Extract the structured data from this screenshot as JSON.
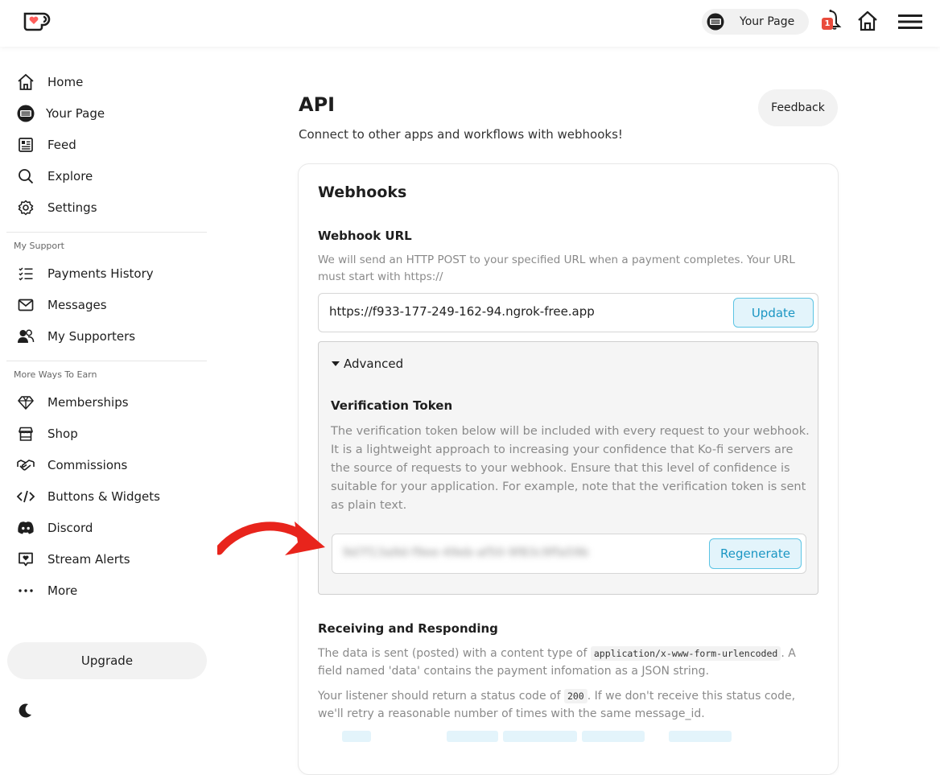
{
  "topbar": {
    "your_page_label": "Your Page",
    "notification_count": "1",
    "icons": [
      "kofi-logo-icon",
      "avatar-icon",
      "bell-icon",
      "home-icon",
      "menu-icon"
    ]
  },
  "sidebar": {
    "items": [
      {
        "label": "Home",
        "icon": "home-icon"
      },
      {
        "label": "Your Page",
        "icon": "avatar-icon"
      },
      {
        "label": "Feed",
        "icon": "feed-icon"
      },
      {
        "label": "Explore",
        "icon": "search-icon"
      },
      {
        "label": "Settings",
        "icon": "gear-icon"
      }
    ],
    "my_support_label": "My Support",
    "support_items": [
      {
        "label": "Payments History",
        "icon": "checklist-icon"
      },
      {
        "label": "Messages",
        "icon": "mail-icon"
      },
      {
        "label": "My Supporters",
        "icon": "users-icon"
      }
    ],
    "more_ways_label": "More Ways To Earn",
    "earn_items": [
      {
        "label": "Memberships",
        "icon": "diamond-icon"
      },
      {
        "label": "Shop",
        "icon": "shop-icon"
      },
      {
        "label": "Commissions",
        "icon": "handshake-icon"
      },
      {
        "label": "Buttons & Widgets",
        "icon": "code-icon"
      },
      {
        "label": "Discord",
        "icon": "discord-icon"
      },
      {
        "label": "Stream Alerts",
        "icon": "alert-icon"
      },
      {
        "label": "More",
        "icon": "more-icon"
      }
    ],
    "upgrade_label": "Upgrade"
  },
  "main": {
    "title": "API",
    "subtitle": "Connect to other apps and workflows with webhooks!",
    "feedback_label": "Feedback",
    "webhooks": {
      "title": "Webhooks",
      "url_label": "Webhook URL",
      "url_help": "We will send an HTTP POST to your specified URL when a payment completes. Your URL must start with https://",
      "url_value": "https://f933-177-249-162-94.ngrok-free.app",
      "update_label": "Update",
      "advanced_label": "Advanced",
      "verification_label": "Verification Token",
      "verification_help": "The verification token below will be included with every request to your webhook. It is a lightweight approach to increasing your confidence that Ko-fi servers are the source of requests to your webhook. Ensure that this level of confidence is suitable for your application. For example, note that the verification token is sent as plain text.",
      "token_value": "9d7f13a9d-f9ee-49eb-af50-9f83c9ffa59b",
      "regenerate_label": "Regenerate",
      "rr_label": "Receiving and Responding",
      "rr_p1_a": "The data is sent (posted) with a content type of ",
      "rr_p1_code": "application/x-www-form-urlencoded",
      "rr_p1_b": ". A field named 'data' contains the payment infomation as a JSON string.",
      "rr_p2_a": "Your listener should return a status code of ",
      "rr_p2_code": "200",
      "rr_p2_b": ". If we don't receive this status code, we'll retry a reasonable number of times with the same message_id."
    }
  },
  "colors": {
    "accent": "#1b96c3",
    "accent_bg": "#e3f4fb",
    "arrow": "#e8241c",
    "badge": "#e94b3c"
  }
}
